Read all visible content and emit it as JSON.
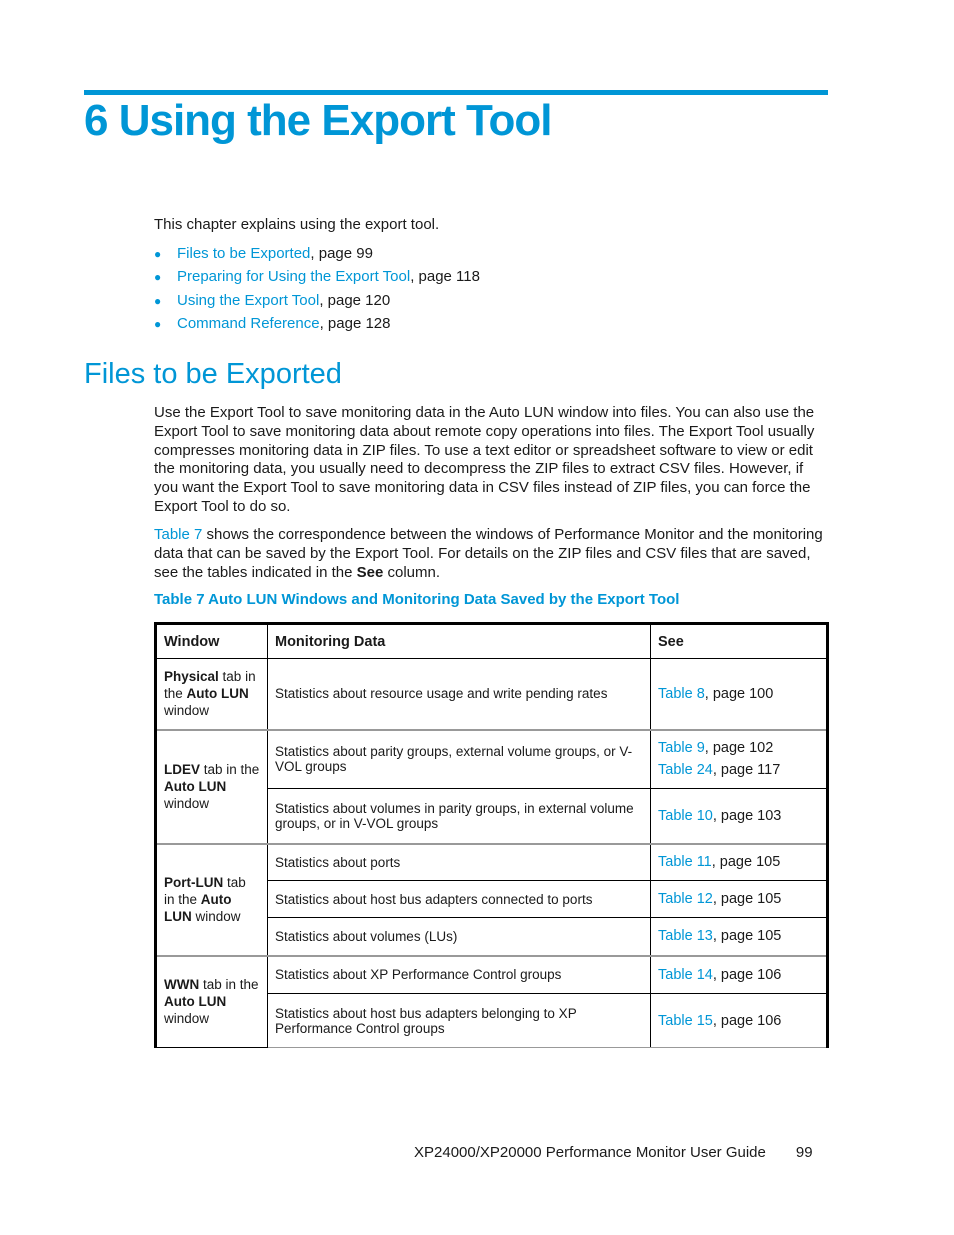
{
  "chapter": {
    "title": "6 Using the Export Tool"
  },
  "intro": "This chapter explains using the export tool.",
  "toc": [
    {
      "link": "Files to be Exported",
      "suffix": ", page 99"
    },
    {
      "link": "Preparing for Using the Export Tool",
      "suffix": ", page 118"
    },
    {
      "link": "Using the Export Tool",
      "suffix": ", page 120"
    },
    {
      "link": "Command Reference",
      "suffix": ", page 128"
    }
  ],
  "section": {
    "title": "Files to be Exported",
    "para1": "Use the Export Tool to save monitoring data in the Auto LUN window into files. You can also use the Export Tool to save monitoring data about remote copy operations into files. The Export Tool usually compresses monitoring data in ZIP files. To use a text editor or spreadsheet software to view or edit the monitoring data, you usually need to decompress the ZIP files to extract CSV files. However, if you want the Export Tool to save monitoring data in CSV files instead of ZIP files, you can force the Export Tool to do so.",
    "para2": {
      "link": "Table 7",
      "text1": " shows the correspondence between the windows of Performance Monitor and the monitoring data that can be saved by the Export Tool. For details on the ZIP files and CSV files that are saved, see the tables indicated in the ",
      "bold": "See",
      "text2": " column."
    }
  },
  "table": {
    "caption": "Table 7 Auto LUN Windows and Monitoring Data Saved by the Export Tool",
    "headers": [
      "Window",
      "Monitoring Data",
      "See"
    ],
    "groups": [
      {
        "window": {
          "bold1": "Physical",
          "t1": " tab in the ",
          "bold2": "Auto LUN",
          "t2": " window"
        },
        "rows": [
          {
            "data": "Statistics about resource usage and write pending rates",
            "see": [
              {
                "link": "Table 8",
                "suffix": ", page 100"
              }
            ]
          }
        ]
      },
      {
        "window": {
          "bold1": "LDEV",
          "t1": " tab in the ",
          "bold2": "Auto LUN",
          "t2": " window"
        },
        "rows": [
          {
            "data": "Statistics about parity groups, external volume groups, or V-VOL groups",
            "see": [
              {
                "link": "Table 9",
                "suffix": ", page 102"
              },
              {
                "link": "Table 24",
                "suffix": ", page 117"
              }
            ]
          },
          {
            "data": "Statistics about volumes in parity groups, in external volume groups, or in V-VOL groups",
            "see": [
              {
                "link": "Table 10",
                "suffix": ", page 103"
              }
            ]
          }
        ]
      },
      {
        "window": {
          "bold1": "Port-LUN",
          "t1": " tab in the ",
          "bold2": "Auto LUN",
          "t2": " window"
        },
        "rows": [
          {
            "data": "Statistics about ports",
            "see": [
              {
                "link": "Table 11",
                "suffix": ", page 105"
              }
            ]
          },
          {
            "data": "Statistics about host bus adapters connected to ports",
            "see": [
              {
                "link": "Table 12",
                "suffix": ", page 105"
              }
            ]
          },
          {
            "data": "Statistics about volumes (LUs)",
            "see": [
              {
                "link": "Table 13",
                "suffix": ", page 105"
              }
            ]
          }
        ]
      },
      {
        "window": {
          "bold1": "WWN",
          "t1": " tab in the ",
          "bold2": "Auto LUN",
          "t2": " window"
        },
        "rows": [
          {
            "data": "Statistics about XP Performance Control groups",
            "see": [
              {
                "link": "Table 14",
                "suffix": ", page 106"
              }
            ]
          },
          {
            "data": "Statistics about host bus adapters belonging to XP Performance Control groups",
            "see": [
              {
                "link": "Table 15",
                "suffix": ", page 106"
              }
            ]
          }
        ]
      }
    ]
  },
  "footer": {
    "title": "XP24000/XP20000 Performance Monitor User Guide",
    "page": "99"
  }
}
